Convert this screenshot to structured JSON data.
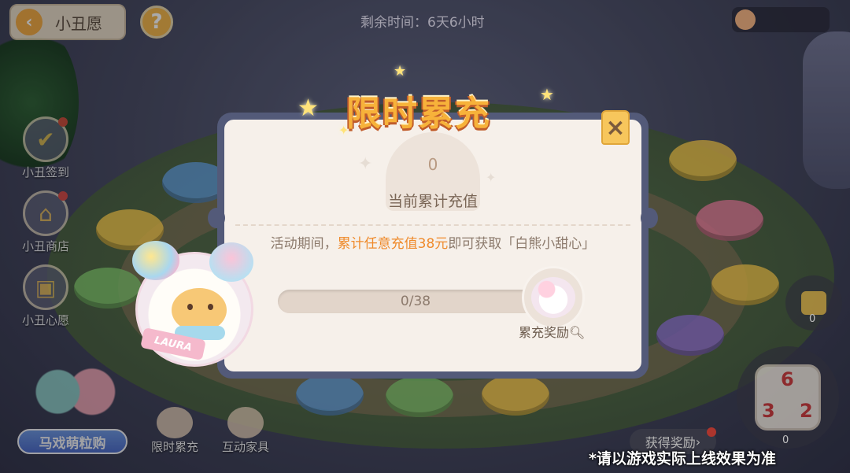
{
  "header": {
    "back_icon": "chevron-left-icon",
    "title": "小丑愿",
    "help_icon": "question-icon",
    "help_glyph": "?",
    "timer": "剩余时间：6天6小时"
  },
  "sidebar": {
    "items": [
      {
        "label": "小丑签到",
        "icon": "calendar-check-icon",
        "has_dot": true
      },
      {
        "label": "小丑商店",
        "icon": "shop-icon",
        "has_dot": true
      },
      {
        "label": "小丑心愿",
        "icon": "wish-book-icon",
        "has_dot": false
      }
    ]
  },
  "bottom": {
    "featured_label": "马戏萌粒购",
    "items": [
      {
        "label": "限时累充",
        "icon": "mascot-icon"
      },
      {
        "label": "互动家具",
        "icon": "furniture-icon"
      }
    ],
    "reward_button": "获得奖励",
    "dice_small_count": "0",
    "dice_big_count": "0",
    "dice_faces": [
      "6",
      "3",
      "2"
    ],
    "disclaimer": "*请以游戏实际上线效果为准"
  },
  "modal": {
    "title": "限时累充",
    "close_glyph": "×",
    "current_value": "0",
    "current_label": "当前累计充值",
    "description_prefix": "活动期间，",
    "description_highlight": "累计任意充值38元",
    "description_suffix": "即可获取「白熊小甜心」",
    "progress_text": "0/38",
    "progress_fraction": 0,
    "reward_label": "累充奖励",
    "reward_search_icon": "magnifier-icon",
    "mascot_ribbon": "LAURA"
  },
  "colors": {
    "accent_orange": "#ef8a2b",
    "title_gold": "#f7b23a",
    "modal_frame": "#535a79",
    "modal_bg": "#f6f0ea",
    "notification_red": "#e6473d"
  }
}
